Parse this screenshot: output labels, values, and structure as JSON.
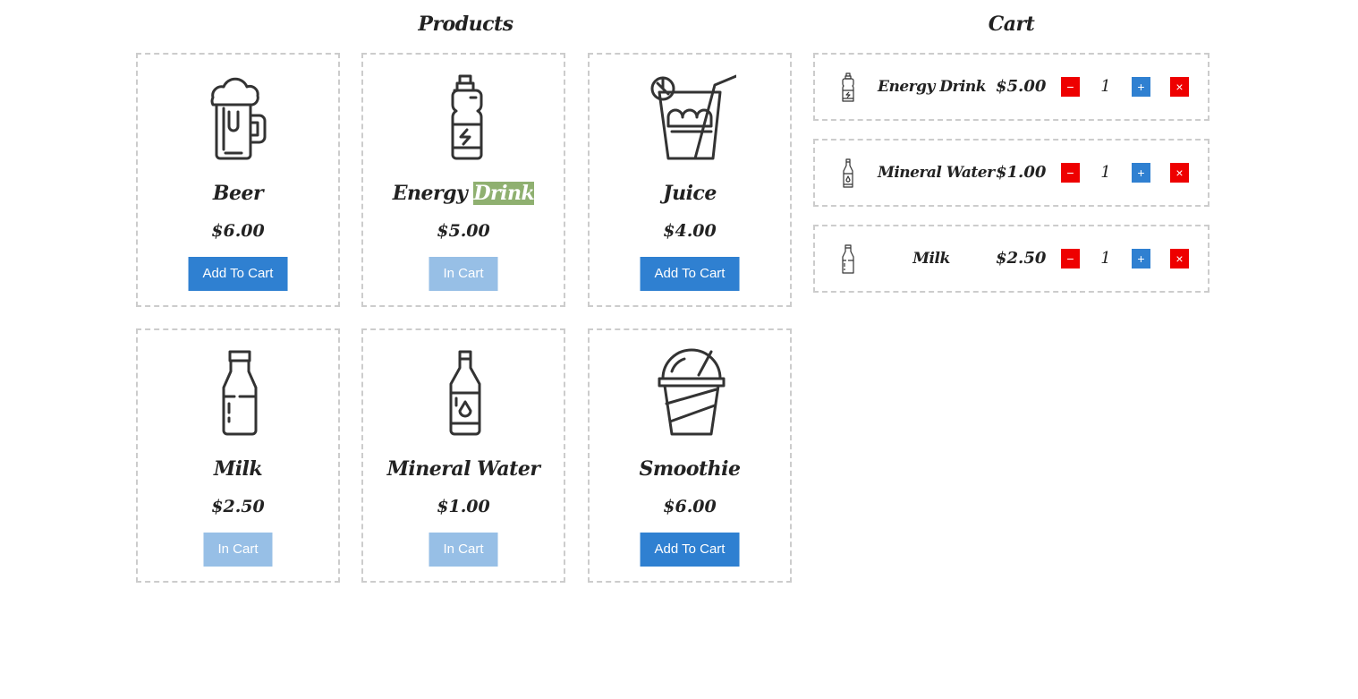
{
  "products_title": "Products",
  "cart_title": "Cart",
  "products": [
    {
      "icon": "beer-mug-icon",
      "name": "Beer",
      "price": "$6.00",
      "button": "Add To Cart",
      "in_cart": false
    },
    {
      "icon": "energy-drink-bottle-icon",
      "name_main": "Energy ",
      "name_highlight": "Drink",
      "price": "$5.00",
      "button": "In Cart",
      "in_cart": true
    },
    {
      "icon": "juice-glass-icon",
      "name": "Juice",
      "price": "$4.00",
      "button": "Add To Cart",
      "in_cart": false
    },
    {
      "icon": "milk-bottle-icon",
      "name": "Milk",
      "price": "$2.50",
      "button": "In Cart",
      "in_cart": true
    },
    {
      "icon": "water-bottle-icon",
      "name": "Mineral Water",
      "price": "$1.00",
      "button": "In Cart",
      "in_cart": true
    },
    {
      "icon": "smoothie-cup-icon",
      "name": "Smoothie",
      "price": "$6.00",
      "button": "Add To Cart",
      "in_cart": false
    }
  ],
  "cart": [
    {
      "icon": "energy-drink-bottle-icon",
      "name": "Energy Drink",
      "price": "$5.00",
      "qty": "1",
      "minus": "−",
      "plus": "+",
      "remove": "×"
    },
    {
      "icon": "water-bottle-icon",
      "name": "Mineral Water",
      "price": "$1.00",
      "qty": "1",
      "minus": "−",
      "plus": "+",
      "remove": "×"
    },
    {
      "icon": "milk-bottle-icon",
      "name": "Milk",
      "price": "$2.50",
      "qty": "1",
      "minus": "−",
      "plus": "+",
      "remove": "×"
    }
  ],
  "colors": {
    "primary": "#2f80d1",
    "primary_disabled": "#97bfe6",
    "danger": "#ee0000",
    "highlight": "#8fb070",
    "border": "#cccccc"
  }
}
